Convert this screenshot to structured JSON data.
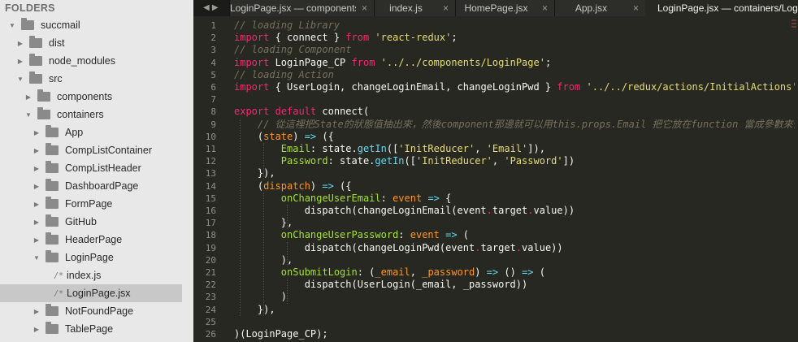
{
  "sidebar": {
    "header": "FOLDERS",
    "items": [
      {
        "label": "succmail",
        "type": "folder",
        "open": true,
        "depth": 0
      },
      {
        "label": "dist",
        "type": "folder",
        "open": false,
        "depth": 1
      },
      {
        "label": "node_modules",
        "type": "folder",
        "open": false,
        "depth": 1
      },
      {
        "label": "src",
        "type": "folder",
        "open": true,
        "depth": 1
      },
      {
        "label": "components",
        "type": "folder",
        "open": false,
        "depth": 2
      },
      {
        "label": "containers",
        "type": "folder",
        "open": true,
        "depth": 2
      },
      {
        "label": "App",
        "type": "folder",
        "open": false,
        "depth": 3
      },
      {
        "label": "CompListContainer",
        "type": "folder",
        "open": false,
        "depth": 3
      },
      {
        "label": "CompListHeader",
        "type": "folder",
        "open": false,
        "depth": 3
      },
      {
        "label": "DashboardPage",
        "type": "folder",
        "open": false,
        "depth": 3
      },
      {
        "label": "FormPage",
        "type": "folder",
        "open": false,
        "depth": 3
      },
      {
        "label": "GitHub",
        "type": "folder",
        "open": false,
        "depth": 3
      },
      {
        "label": "HeaderPage",
        "type": "folder",
        "open": false,
        "depth": 3
      },
      {
        "label": "LoginPage",
        "type": "folder",
        "open": true,
        "depth": 3
      },
      {
        "label": "index.js",
        "type": "file",
        "depth": 4,
        "icon_text": "/*"
      },
      {
        "label": "LoginPage.jsx",
        "type": "file",
        "depth": 4,
        "icon_text": "/*",
        "selected": true
      },
      {
        "label": "NotFoundPage",
        "type": "folder",
        "open": false,
        "depth": 3
      },
      {
        "label": "TablePage",
        "type": "folder",
        "open": false,
        "depth": 3
      }
    ]
  },
  "tabs": [
    {
      "label": "LoginPage.jsx — components",
      "close": "×",
      "active": false
    },
    {
      "label": "index.js",
      "close": "×",
      "active": false
    },
    {
      "label": "HomePage.jsx",
      "close": "×",
      "active": false
    },
    {
      "label": "App.jsx",
      "close": "×",
      "active": false
    },
    {
      "label": "LoginPage.jsx — containers/LoginPage",
      "active": true
    }
  ],
  "tab_nav": "◀ ▶",
  "code_lines": [
    {
      "n": "1",
      "tokens": [
        [
          "cm",
          "// loading Library"
        ]
      ]
    },
    {
      "n": "2",
      "tokens": [
        [
          "kw",
          "import"
        ],
        [
          "tx",
          " { connect } "
        ],
        [
          "kw",
          "from"
        ],
        [
          "tx",
          " "
        ],
        [
          "st",
          "'react-redux'"
        ],
        [
          "tx",
          ";"
        ]
      ]
    },
    {
      "n": "3",
      "tokens": [
        [
          "cm",
          "// loading Component"
        ]
      ]
    },
    {
      "n": "4",
      "tokens": [
        [
          "kw",
          "import"
        ],
        [
          "tx",
          " LoginPage_CP "
        ],
        [
          "kw",
          "from"
        ],
        [
          "tx",
          " "
        ],
        [
          "st",
          "'../../components/LoginPage'"
        ],
        [
          "tx",
          ";"
        ]
      ]
    },
    {
      "n": "5",
      "tokens": [
        [
          "cm",
          "// loading Action"
        ]
      ]
    },
    {
      "n": "6",
      "tokens": [
        [
          "kw",
          "import"
        ],
        [
          "tx",
          " { UserLogin, changeLoginEmail, changeLoginPwd } "
        ],
        [
          "kw",
          "from"
        ],
        [
          "tx",
          " "
        ],
        [
          "st",
          "'../../redux/actions/InitialActions'"
        ],
        [
          "tx",
          ";"
        ]
      ]
    },
    {
      "n": "7",
      "tokens": []
    },
    {
      "n": "8",
      "tokens": [
        [
          "kw",
          "export"
        ],
        [
          "tx",
          " "
        ],
        [
          "kw",
          "default"
        ],
        [
          "tx",
          " connect("
        ]
      ]
    },
    {
      "n": "9",
      "tokens": [
        [
          "tx",
          "    "
        ],
        [
          "cm",
          "// 從這裡把State的狀態值抽出來，然後component那邊就可以用this.props.Email 把它放在function 當成參數來傳"
        ]
      ]
    },
    {
      "n": "10",
      "tokens": [
        [
          "tx",
          "    ("
        ],
        [
          "pa",
          "state"
        ],
        [
          "tx",
          ") "
        ],
        [
          "ar",
          "=>"
        ],
        [
          "tx",
          " ({"
        ]
      ]
    },
    {
      "n": "11",
      "tokens": [
        [
          "tx",
          "        "
        ],
        [
          "pr",
          "Email"
        ],
        [
          "tx",
          ": state."
        ],
        [
          "fn",
          "getIn"
        ],
        [
          "tx",
          "(["
        ],
        [
          "st",
          "'InitReducer'"
        ],
        [
          "tx",
          ", "
        ],
        [
          "st",
          "'Email'"
        ],
        [
          "tx",
          "]),"
        ]
      ]
    },
    {
      "n": "12",
      "tokens": [
        [
          "tx",
          "        "
        ],
        [
          "pr",
          "Password"
        ],
        [
          "tx",
          ": state."
        ],
        [
          "fn",
          "getIn"
        ],
        [
          "tx",
          "(["
        ],
        [
          "st",
          "'InitReducer'"
        ],
        [
          "tx",
          ", "
        ],
        [
          "st",
          "'Password'"
        ],
        [
          "tx",
          "])"
        ]
      ]
    },
    {
      "n": "13",
      "tokens": [
        [
          "tx",
          "    }),"
        ]
      ]
    },
    {
      "n": "14",
      "tokens": [
        [
          "tx",
          "    ("
        ],
        [
          "pa",
          "dispatch"
        ],
        [
          "tx",
          ") "
        ],
        [
          "ar",
          "=>"
        ],
        [
          "tx",
          " ({"
        ]
      ]
    },
    {
      "n": "15",
      "tokens": [
        [
          "tx",
          "        "
        ],
        [
          "pr",
          "onChangeUserEmail"
        ],
        [
          "tx",
          ": "
        ],
        [
          "pa",
          "event"
        ],
        [
          "tx",
          " "
        ],
        [
          "ar",
          "=>"
        ],
        [
          "tx",
          " {"
        ]
      ]
    },
    {
      "n": "16",
      "tokens": [
        [
          "tx",
          "            dispatch(changeLoginEmail(event"
        ],
        [
          "op",
          "."
        ],
        [
          "tx",
          "target"
        ],
        [
          "op",
          "."
        ],
        [
          "tx",
          "value))"
        ]
      ]
    },
    {
      "n": "17",
      "tokens": [
        [
          "tx",
          "        },"
        ]
      ]
    },
    {
      "n": "18",
      "tokens": [
        [
          "tx",
          "        "
        ],
        [
          "pr",
          "onChangeUserPassword"
        ],
        [
          "tx",
          ": "
        ],
        [
          "pa",
          "event"
        ],
        [
          "tx",
          " "
        ],
        [
          "ar",
          "=>"
        ],
        [
          "tx",
          " ("
        ]
      ]
    },
    {
      "n": "19",
      "tokens": [
        [
          "tx",
          "            dispatch(changeLoginPwd(event"
        ],
        [
          "op",
          "."
        ],
        [
          "tx",
          "target"
        ],
        [
          "op",
          "."
        ],
        [
          "tx",
          "value))"
        ]
      ]
    },
    {
      "n": "20",
      "tokens": [
        [
          "tx",
          "        ),"
        ]
      ]
    },
    {
      "n": "21",
      "tokens": [
        [
          "tx",
          "        "
        ],
        [
          "pr",
          "onSubmitLogin"
        ],
        [
          "tx",
          ": ("
        ],
        [
          "pa",
          "_email"
        ],
        [
          "tx",
          ", "
        ],
        [
          "pa",
          "_password"
        ],
        [
          "tx",
          ") "
        ],
        [
          "ar",
          "=>"
        ],
        [
          "tx",
          " () "
        ],
        [
          "ar",
          "=>"
        ],
        [
          "tx",
          " ("
        ]
      ]
    },
    {
      "n": "22",
      "tokens": [
        [
          "tx",
          "            dispatch(UserLogin(_email, _password))"
        ]
      ]
    },
    {
      "n": "23",
      "tokens": [
        [
          "tx",
          "        )"
        ]
      ]
    },
    {
      "n": "24",
      "tokens": [
        [
          "tx",
          "    }),"
        ]
      ]
    },
    {
      "n": "25",
      "tokens": []
    },
    {
      "n": "26",
      "tokens": [
        [
          "tx",
          ")(LoginPage_CP);"
        ]
      ]
    }
  ],
  "colors": {
    "comment": "#75715e",
    "keyword": "#f92672",
    "string": "#e6db74",
    "arrow": "#66d9ef",
    "param": "#fd971f",
    "property": "#a6e22e",
    "text": "#f8f8f2",
    "background": "#272822"
  }
}
